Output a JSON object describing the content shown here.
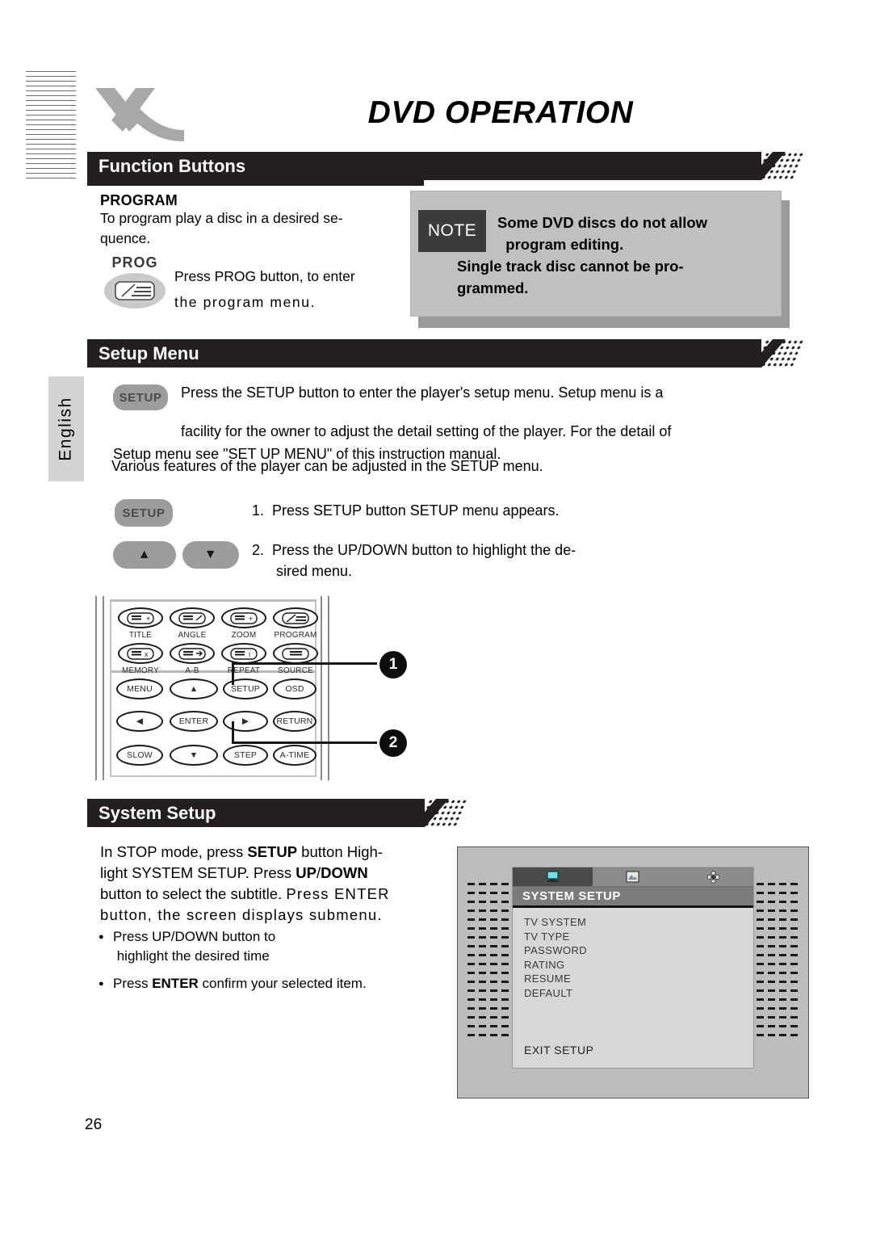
{
  "page": {
    "title": "DVD OPERATION",
    "number": "26",
    "language_tab": "English",
    "logo": "x-logo"
  },
  "sections": {
    "function_buttons": {
      "header": "Function Buttons",
      "program": {
        "heading": "PROGRAM",
        "description": "To program play a disc in a desired se-quence.",
        "key_label": "PROG",
        "key_icon": "program-key-icon",
        "instruction_line1": "Press PROG button, to enter",
        "instruction_line2": "the   program menu."
      },
      "note": {
        "tag": "NOTE",
        "line1": "Some DVD discs do not allow",
        "line2": "program editing.",
        "line3": "Single track disc cannot be pro-",
        "line4": "grammed."
      }
    },
    "setup_menu": {
      "header": "Setup Menu",
      "setup_button_label": "SETUP",
      "paragraph_line1": "Press the SETUP button to enter the player's setup menu. Setup menu is a",
      "paragraph_line2": "facility for the owner to adjust the detail setting of the player. For the detail of",
      "paragraph_line3": "Setup menu see \"SET UP MENU\" of this instruction manual.",
      "various": "Various features of the player can be adjusted in the SETUP menu.",
      "steps": [
        {
          "num": "1.",
          "text": "Press SETUP button SETUP menu appears."
        },
        {
          "num": "2.",
          "text": "Press the UP/DOWN button to highlight the de-sired menu."
        }
      ],
      "up_button": "▲",
      "down_button": "▼"
    },
    "remote": {
      "keys_row1": [
        {
          "label": "TITLE",
          "icon": "title-key-icon"
        },
        {
          "label": "ANGLE",
          "icon": "angle-key-icon"
        },
        {
          "label": "ZOOM",
          "icon": "zoom-key-icon"
        },
        {
          "label": "PROGRAM",
          "icon": "program-key-icon"
        }
      ],
      "keys_row2": [
        {
          "label": "MEMORY",
          "icon": "memory-key-icon"
        },
        {
          "label": "A-B",
          "icon": "ab-key-icon"
        },
        {
          "label": "REPEAT",
          "icon": "repeat-key-icon"
        },
        {
          "label": "SOURCE",
          "icon": "source-key-icon"
        }
      ],
      "keys_grid": [
        [
          "MENU",
          "▲",
          "SETUP",
          "OSD"
        ],
        [
          "◀",
          "ENTER",
          "▶",
          "RETURN"
        ],
        [
          "SLOW",
          "▼",
          "STEP",
          "A-TIME"
        ]
      ],
      "callouts": [
        "1",
        "2"
      ]
    },
    "system_setup": {
      "header": "System Setup",
      "paragraph_line1": "In STOP mode, press SETUP button High-",
      "paragraph_line2": "light SYSTEM SETUP. Press UP/DOWN",
      "paragraph_line3": "button to select the subtitle. Press ENTER",
      "paragraph_line4": "button, the screen displays submenu.",
      "bold_terms": [
        "SETUP",
        "UP/DOWN",
        "ENTER"
      ],
      "bullets": [
        "Press UP/DOWN button to highlight the desired time",
        "Press ENTER confirm your selected item."
      ],
      "bullet2_bold": "ENTER",
      "osd": {
        "tabs": [
          "monitor-icon",
          "picture-icon",
          "gear-icon"
        ],
        "active_tab": 0,
        "title": "SYSTEM SETUP",
        "items": [
          "TV SYSTEM",
          "TV TYPE",
          "PASSWORD",
          "RATING",
          "RESUME",
          "DEFAULT"
        ],
        "exit": "EXIT SETUP"
      }
    }
  },
  "colors": {
    "header_bar": "#231f20",
    "note_box": "#c0c0c0",
    "note_tag": "#3b3b3b",
    "button_gray": "#9c9c9c",
    "language_tab": "#d4d4d4",
    "osd_bg": "#bdbdbd",
    "osd_panel": "#d7d7d7",
    "logo_gray": "#a8a8a8"
  }
}
